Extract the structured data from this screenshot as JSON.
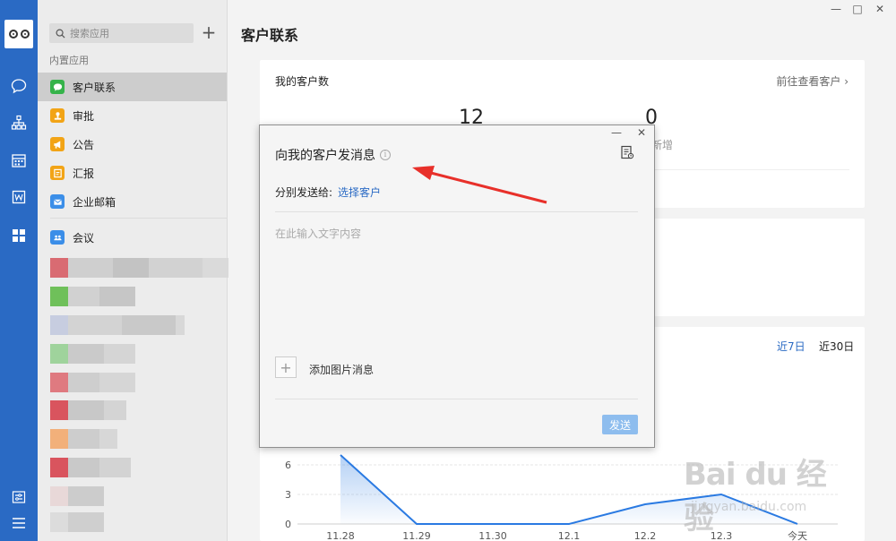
{
  "rail": {
    "icons": [
      "chat-icon",
      "org-icon",
      "calendar-icon",
      "doc-icon",
      "apps-icon",
      "settings-icon",
      "menu-icon"
    ]
  },
  "sidebar": {
    "search_placeholder": "搜索应用",
    "add_label": "+",
    "section_label": "内置应用",
    "items": [
      {
        "label": "客户联系",
        "color": "#35b34a",
        "icon": "chat-bubble-icon"
      },
      {
        "label": "审批",
        "color": "#f2a416",
        "icon": "stamp-icon"
      },
      {
        "label": "公告",
        "color": "#f2a416",
        "icon": "megaphone-icon"
      },
      {
        "label": "汇报",
        "color": "#f2a416",
        "icon": "report-icon"
      },
      {
        "label": "企业邮箱",
        "color": "#3b8ee8",
        "icon": "mail-icon"
      },
      {
        "label": "会议",
        "color": "#3b8ee8",
        "icon": "meeting-icon"
      }
    ]
  },
  "main": {
    "title": "客户联系",
    "card1": {
      "title": "我的客户数",
      "link": "前往查看客户",
      "stat_total": "12",
      "stat_new": "0",
      "stat_new_label": "新增"
    },
    "range_tabs": [
      "近7日",
      "近30日"
    ],
    "active_color": "#2a6ac4"
  },
  "modal": {
    "title": "向我的客户发消息",
    "info": "i",
    "send_label": "分别发送给:",
    "select_link": "选择客户",
    "text_placeholder": "在此输入文字内容",
    "add_image_label": "添加图片消息",
    "send_button": "发送"
  },
  "chart_data": {
    "type": "area",
    "categories": [
      "11.28",
      "11.29",
      "11.30",
      "12.1",
      "12.2",
      "12.3",
      "今天"
    ],
    "values": [
      7,
      0,
      0,
      0,
      2,
      3,
      0
    ],
    "y_ticks": [
      0,
      3,
      6
    ],
    "ylim": [
      0,
      8
    ],
    "color": "#2a7ae2"
  },
  "watermark": {
    "main": "Bai du 经验",
    "sub": "jingyan.baidu.com"
  }
}
